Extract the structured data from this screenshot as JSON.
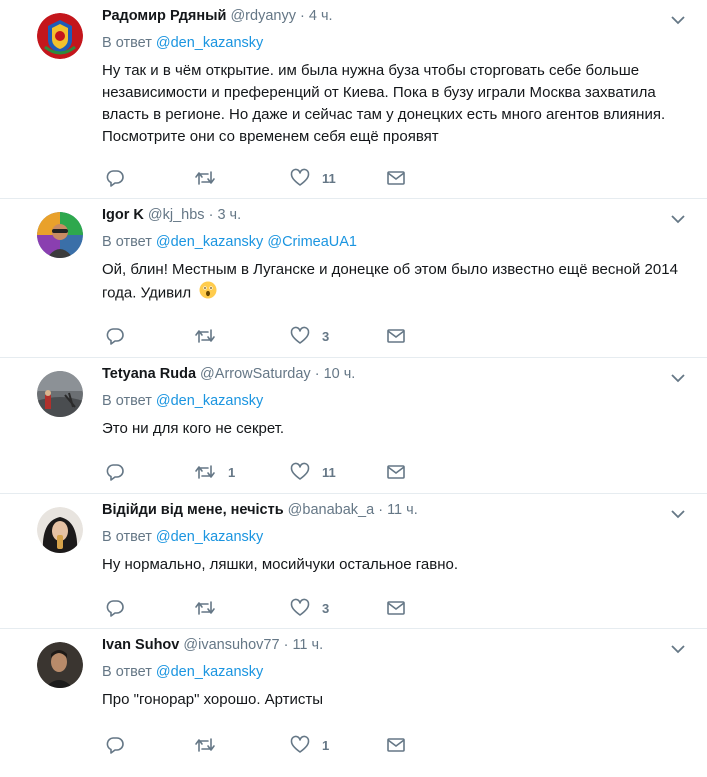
{
  "reply_prefix": "В ответ",
  "tweets": [
    {
      "name": "Радомир Рдяный",
      "handle": "@rdyanyy",
      "time": "4 ч.",
      "mentions": [
        "@den_kazansky"
      ],
      "text": "Ну так и в чём открытие. им была нужна буза чтобы сторговать себе больше независимости и преференций от Киева. Пока в бузу играли Москва захватила власть в регионе. Но даже и сейчас там у донецких есть много агентов влияния. Посмотрите они со временем себя ещё проявят",
      "retweets": "",
      "likes": "11"
    },
    {
      "name": "Igor K",
      "handle": "@kj_hbs",
      "time": "3 ч.",
      "mentions": [
        "@den_kazansky",
        "@CrimeaUA1"
      ],
      "text": "Ой, блин! Местным в Луганске и донецке об этом было известно ещё весной 2014 года. Удивил",
      "emoji": "astonished-face",
      "retweets": "",
      "likes": "3"
    },
    {
      "name": "Tetyana Ruda",
      "handle": "@ArrowSaturday",
      "time": "10 ч.",
      "mentions": [
        "@den_kazansky"
      ],
      "text": "Это ни для кого не секрет.",
      "retweets": "1",
      "likes": "11"
    },
    {
      "name": "Відійди від мене, нечість",
      "handle": "@banabak_a",
      "time": "11 ч.",
      "mentions": [
        "@den_kazansky"
      ],
      "text": "Ну нормально, ляшки, мосийчуки остальное гавно.",
      "retweets": "",
      "likes": "3"
    },
    {
      "name": "Ivan Suhov",
      "handle": "@ivansuhov77",
      "time": "11 ч.",
      "mentions": [
        "@den_kazansky"
      ],
      "text": "Про \"гонорар\" хорошо. Артисты",
      "retweets": "",
      "likes": "1"
    }
  ],
  "colors": {
    "link": "#1b95e0",
    "secondary": "#657786",
    "text": "#14171a",
    "divider": "#e6ecf0"
  },
  "icons": [
    "reply-icon",
    "retweet-icon",
    "like-icon",
    "dm-icon",
    "chevron-down-icon"
  ]
}
